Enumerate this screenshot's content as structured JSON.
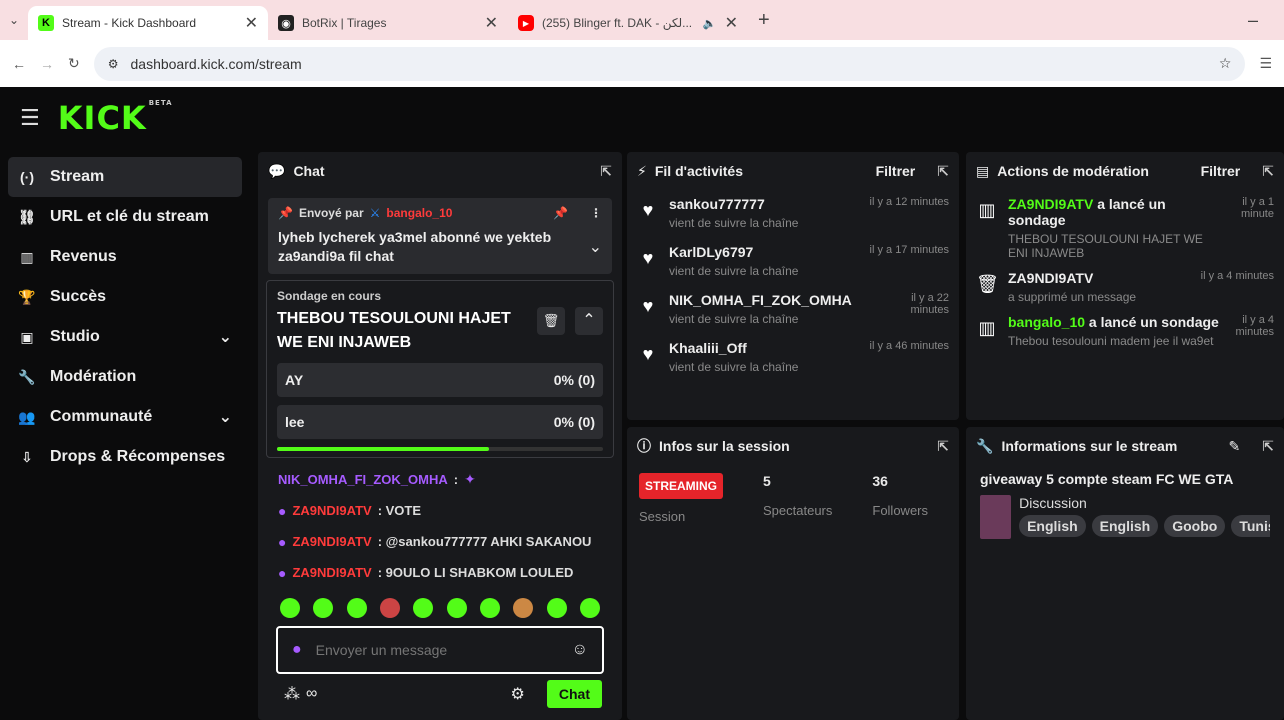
{
  "browser": {
    "tabs": [
      {
        "title": "Stream - Kick Dashboard",
        "icon": "kick-icon"
      },
      {
        "title": "BotRix | Tirages",
        "icon": "botrix-icon"
      },
      {
        "title": "(255) Blinger ft. DAK - لكن...",
        "icon": "youtube-icon"
      }
    ],
    "url": "dashboard.kick.com/stream"
  },
  "brand": {
    "logo": "KICK",
    "tag": "BETA"
  },
  "sidebar": {
    "items": [
      {
        "label": "Stream",
        "icon": "stream-icon"
      },
      {
        "label": "URL et clé du stream",
        "icon": "link-icon"
      },
      {
        "label": "Revenus",
        "icon": "revenue-icon"
      },
      {
        "label": "Succès",
        "icon": "trophy-icon"
      },
      {
        "label": "Studio",
        "icon": "studio-icon"
      },
      {
        "label": "Modération",
        "icon": "wrench-icon"
      },
      {
        "label": "Communauté",
        "icon": "community-icon"
      },
      {
        "label": "Drops & Récompenses",
        "icon": "drops-icon"
      }
    ]
  },
  "chat": {
    "title": "Chat",
    "pinned": {
      "sent_by": "Envoyé par",
      "user": "bangalo_10",
      "message": "lyheb lycherek ya3mel abonné we yekteb za9andi9a fil chat"
    },
    "poll": {
      "label": "Sondage en cours",
      "question": "THEBOU TESOULOUNI HAJET WE ENI INJAWEB",
      "options": [
        {
          "name": "AY",
          "result": "0% (0)"
        },
        {
          "name": "lee",
          "result": "0% (0)"
        }
      ],
      "remaining": 0.65
    },
    "messages": [
      {
        "user": "NIK_OMHA_FI_ZOK_OMHA",
        "text": ""
      },
      {
        "user": "ZA9NDI9ATV",
        "text": ": VOTE"
      },
      {
        "user": "ZA9NDI9ATV",
        "text": ": @sankou777777 AHKI SAKANOU"
      },
      {
        "user": "ZA9NDI9ATV",
        "text": ": 9OULO LI SHABKOM LOULED"
      }
    ],
    "input_placeholder": "Envoyer un message",
    "points": "∞",
    "send_label": "Chat"
  },
  "activity": {
    "title": "Fil d'activités",
    "filter": "Filtrer",
    "items": [
      {
        "user": "sankou777777",
        "desc": "vient de suivre la chaîne",
        "time": "il y a 12 minutes"
      },
      {
        "user": "KarlDLy6797",
        "desc": "vient de suivre la chaîne",
        "time": "il y a 17 minutes"
      },
      {
        "user": "NIK_OMHA_FI_ZOK_OMHA",
        "desc": "vient de suivre la chaîne",
        "time": "il y a 22 minutes"
      },
      {
        "user": "Khaaliii_Off",
        "desc": "vient de suivre la chaîne",
        "time": "il y a 46 minutes"
      }
    ]
  },
  "moderation": {
    "title": "Actions de modération",
    "filter": "Filtrer",
    "items": [
      {
        "user": "ZA9NDI9ATV",
        "action": "a lancé un sondage",
        "detail": "THEBOU TESOULOUNI HAJET WE ENI INJAWEB",
        "time": "il y a 1 minute",
        "icon": "poll-icon"
      },
      {
        "user": "ZA9NDI9ATV",
        "action": "",
        "detail": "a supprimé un message",
        "time": "il y a 4 minutes",
        "icon": "trash-icon"
      },
      {
        "user": "bangalo_10",
        "action": "a lancé un sondage",
        "detail": "Thebou tesoulouni madem jee il wa9et",
        "time": "il y a 4 minutes",
        "icon": "poll-icon"
      }
    ]
  },
  "session": {
    "title": "Infos sur la session",
    "status": "STREAMING",
    "status_label": "Session",
    "viewers": "5",
    "viewers_label": "Spectateurs",
    "followers": "36",
    "followers_label": "Followers"
  },
  "stream_info": {
    "title": "Informations sur le stream",
    "stream_title": "giveaway 5 compte steam FC WE GTA",
    "category": "Discussion",
    "tags": [
      "English",
      "English",
      "Goobo",
      "Tunisi"
    ]
  },
  "colors": {
    "accent": "#53fc18",
    "panel": "#18191c",
    "danger": "#e5242a",
    "purple": "#a65bff"
  }
}
